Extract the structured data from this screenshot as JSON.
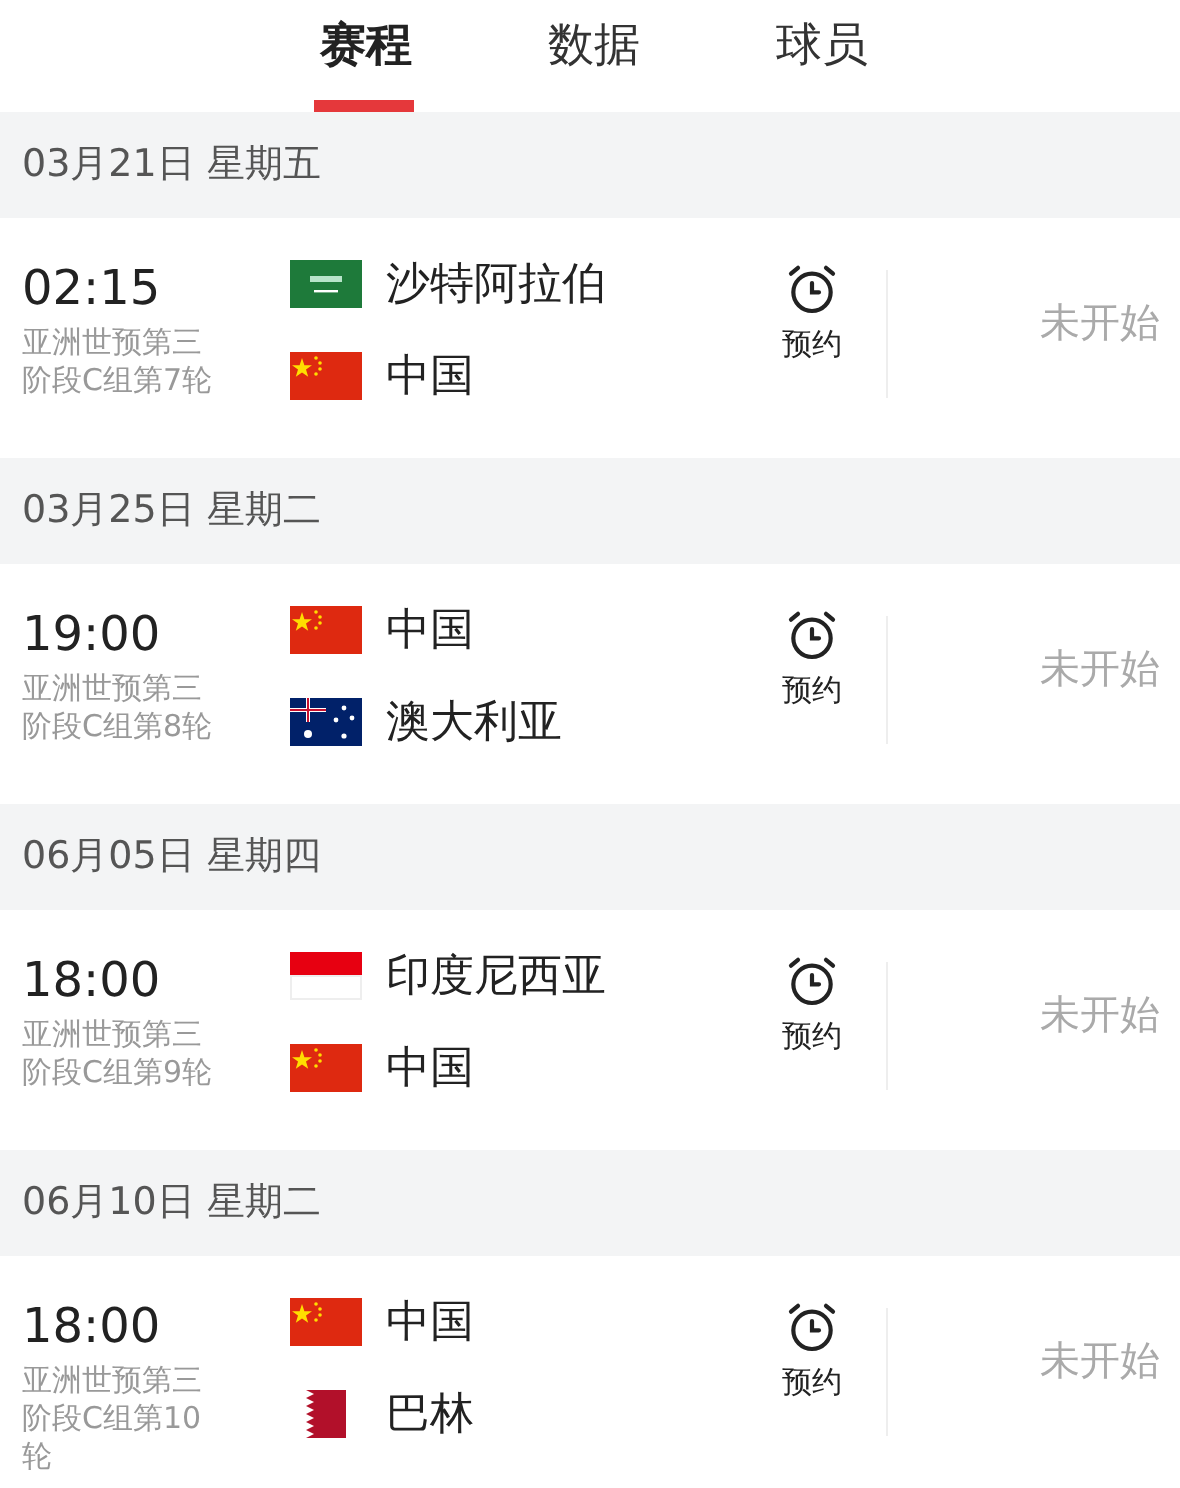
{
  "tabs": [
    {
      "label": "赛程",
      "selected": true
    },
    {
      "label": "数据",
      "selected": false
    },
    {
      "label": "球员",
      "selected": false
    }
  ],
  "days": [
    {
      "date": "03月21日 星期五",
      "matches": [
        {
          "time": "02:15",
          "competition": "亚洲世预第三阶段C组第7轮",
          "teams": [
            {
              "name": "沙特阿拉伯",
              "kind": "saudi"
            },
            {
              "name": "中国",
              "kind": "china"
            }
          ],
          "remind": "预约",
          "status": "未开始"
        }
      ]
    },
    {
      "date": "03月25日 星期二",
      "matches": [
        {
          "time": "19:00",
          "competition": "亚洲世预第三阶段C组第8轮",
          "teams": [
            {
              "name": "中国",
              "kind": "china"
            },
            {
              "name": "澳大利亚",
              "kind": "australia"
            }
          ],
          "remind": "预约",
          "status": "未开始"
        }
      ]
    },
    {
      "date": "06月05日 星期四",
      "matches": [
        {
          "time": "18:00",
          "competition": "亚洲世预第三阶段C组第9轮",
          "teams": [
            {
              "name": "印度尼西亚",
              "kind": "indonesia"
            },
            {
              "name": "中国",
              "kind": "china"
            }
          ],
          "remind": "预约",
          "status": "未开始"
        }
      ]
    },
    {
      "date": "06月10日 星期二",
      "matches": [
        {
          "time": "18:00",
          "competition": "亚洲世预第三阶段C组第10轮",
          "teams": [
            {
              "name": "中国",
              "kind": "china"
            },
            {
              "name": "巴林",
              "kind": "bahrain"
            }
          ],
          "remind": "预约",
          "status": "未开始"
        }
      ]
    }
  ]
}
